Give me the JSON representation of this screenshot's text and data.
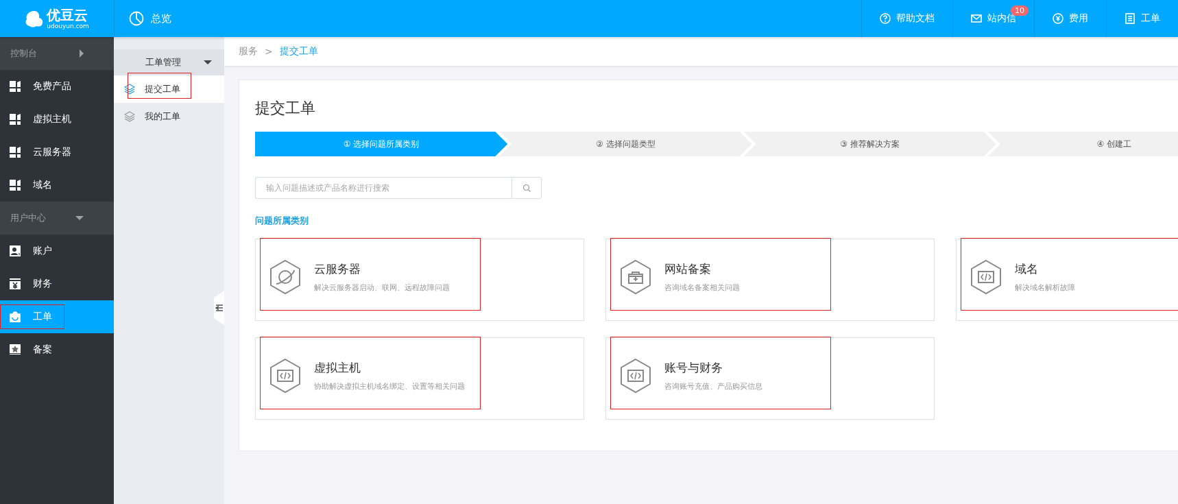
{
  "brand": {
    "name": "优豆云",
    "domain": "udouyun.com"
  },
  "topbar": {
    "page": "总览",
    "nav": [
      {
        "label": "帮助文档",
        "kind": "help"
      },
      {
        "label": "站内信",
        "kind": "mail",
        "badge": "10"
      },
      {
        "label": "费用",
        "kind": "yen"
      },
      {
        "label": "工单",
        "kind": "doc"
      }
    ]
  },
  "sidebar": {
    "sections": [
      {
        "label": "控制台",
        "expanded": false,
        "items": [
          {
            "label": "免费产品",
            "kind": "grid",
            "selected": false,
            "annotated": false
          },
          {
            "label": "虚拟主机",
            "kind": "grid",
            "selected": false,
            "annotated": false
          },
          {
            "label": "云服务器",
            "kind": "grid",
            "selected": false,
            "annotated": false
          },
          {
            "label": "域名",
            "kind": "grid",
            "selected": false,
            "annotated": false
          }
        ]
      },
      {
        "label": "用户中心",
        "expanded": true,
        "items": [
          {
            "label": "账户",
            "kind": "user",
            "selected": false,
            "annotated": false
          },
          {
            "label": "财务",
            "kind": "yen",
            "selected": false,
            "annotated": false
          },
          {
            "label": "工单",
            "kind": "bag",
            "selected": true,
            "annotated": true
          },
          {
            "label": "备案",
            "kind": "star",
            "selected": false,
            "annotated": false
          }
        ]
      }
    ]
  },
  "subnav": {
    "group": "工单管理",
    "expanded": true,
    "items": [
      {
        "label": "提交工单",
        "selected": true,
        "annotated": true
      },
      {
        "label": "我的工单",
        "selected": false,
        "annotated": false
      }
    ]
  },
  "breadcrumb": {
    "separator": ">",
    "items": [
      {
        "label": "服务",
        "current": false
      },
      {
        "label": "提交工单",
        "current": true
      }
    ]
  },
  "panel": {
    "title": "提交工单",
    "steps": [
      {
        "label": "① 选择问题所属类别",
        "selected": true
      },
      {
        "label": "② 选择问题类型",
        "selected": false
      },
      {
        "label": "③ 推荐解决方案",
        "selected": false
      },
      {
        "label": "④ 创建工",
        "selected": false
      }
    ],
    "search": {
      "placeholder": "输入问题描述或产品名称进行搜索"
    },
    "category_heading": "问题所属类别",
    "categories": [
      {
        "title": "云服务器",
        "description": "解决云服务器启动、联网、远程故障问题",
        "kind": "planet",
        "annotated": true
      },
      {
        "title": "网站备案",
        "description": "咨询域名备案相关问题",
        "kind": "toolbox",
        "annotated": true
      },
      {
        "title": "域名",
        "description": "解决域名解析故障",
        "kind": "code",
        "annotated": true
      },
      {
        "title": "虚拟主机",
        "description": "协助解决虚拟主机域名绑定、设置等相关问题",
        "kind": "code",
        "annotated": true
      },
      {
        "title": "账号与财务",
        "description": "咨询账号充值、产品购买信息",
        "kind": "code",
        "annotated": true
      }
    ]
  }
}
